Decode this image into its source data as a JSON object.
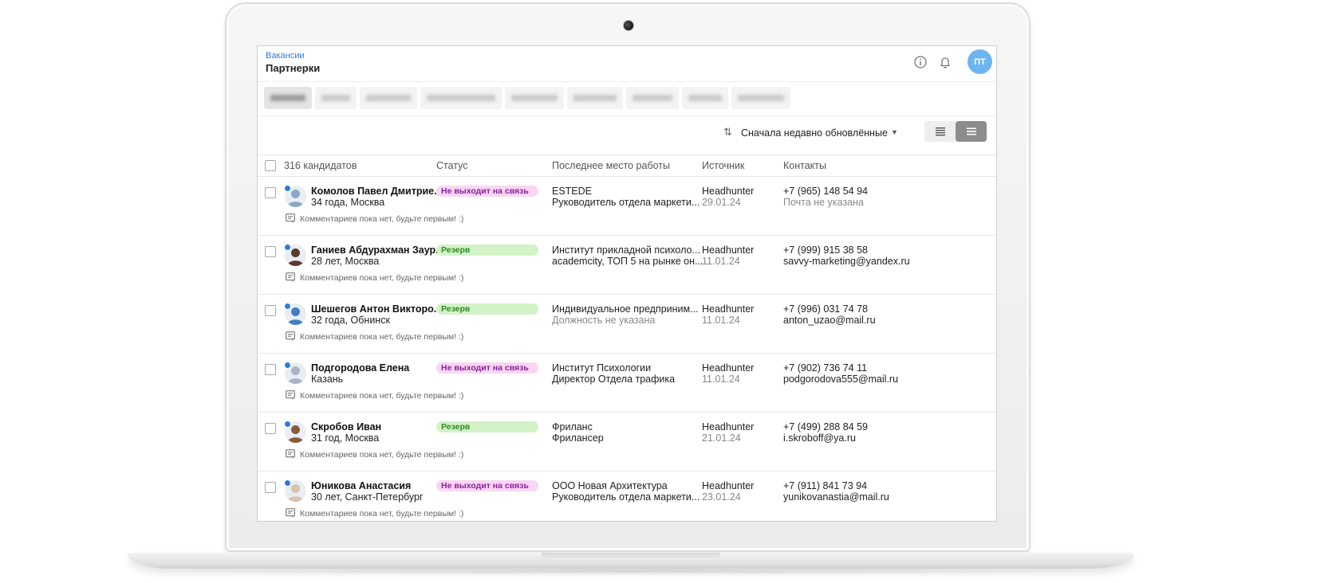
{
  "header": {
    "breadcrumb": "Вакансии",
    "title": "Партнерки",
    "user_initials": "ПТ"
  },
  "toolbar": {
    "sort_label": "Сначала недавно обновлённые"
  },
  "table": {
    "columns": {
      "count": "316 кандидатов",
      "status": "Статус",
      "last_job": "Последнее место работы",
      "source": "Источник",
      "contacts": "Контакты"
    },
    "rows": [
      {
        "name": "Комолов Павел Дмитрие...",
        "meta": "34 года, Москва",
        "comment": "Комментариев пока нет, будьте первым! :)",
        "status": "Не выходит на связь",
        "status_kind": "pink",
        "job_company": "ESTEDE",
        "job_title": "Руководитель отдела маркети...",
        "source": "Headhunter",
        "source_date": "29.01.24",
        "phone": "+7 (965) 148 54 94",
        "email": "Почта не указана",
        "avatar_color": "#8aa6c2"
      },
      {
        "name": "Ганиев Абдурахман Заур...",
        "meta": "28 лет, Москва",
        "comment": "Комментариев пока нет, будьте первым! :)",
        "status": "Резерв",
        "status_kind": "green",
        "job_company": "Институт прикладной психоло...",
        "job_title": "academcity, ТОП 5 на рынке он...",
        "source": "Headhunter",
        "source_date": "11.01.24",
        "phone": "+7 (999) 915 38 58",
        "email": "savvy-marketing@yandex.ru",
        "avatar_color": "#5a3a2a"
      },
      {
        "name": "Шешегов Антон Викторо...",
        "meta": "32 года, Обнинск",
        "comment": "Комментариев пока нет, будьте первым! :)",
        "status": "Резерв",
        "status_kind": "green",
        "job_company": "Индивидуальное предприним...",
        "job_title": "Должность не указана",
        "source": "Headhunter",
        "source_date": "11.01.24",
        "phone": "+7 (996) 031 74 78",
        "email": "anton_uzao@mail.ru",
        "avatar_color": "#3f7fc0"
      },
      {
        "name": "Подгородова Елена",
        "meta": "Казань",
        "comment": "Комментариев пока нет, будьте первым! :)",
        "status": "Не выходит на связь",
        "status_kind": "pink",
        "job_company": "Институт Психологии",
        "job_title": "Директор Отдела трафика",
        "source": "Headhunter",
        "source_date": "11.01.24",
        "phone": "+7 (902) 736 74 11",
        "email": "podgorodova555@mail.ru",
        "avatar_color": "#a9b4c4"
      },
      {
        "name": "Скробов Иван",
        "meta": "31 год, Москва",
        "comment": "Комментариев пока нет, будьте первым! :)",
        "status": "Резерв",
        "status_kind": "green",
        "job_company": "Фриланс",
        "job_title": "Фрилансер",
        "source": "Headhunter",
        "source_date": "21.01.24",
        "phone": "+7 (499) 288 84 59",
        "email": "i.skroboff@ya.ru",
        "avatar_color": "#8a5a3a"
      },
      {
        "name": "Юникова Анастасия",
        "meta": "30 лет, Санкт-Петербург",
        "comment": "Комментариев пока нет, будьте первым! :)",
        "status": "Не выходит на связь",
        "status_kind": "pink",
        "job_company": "ООО Новая Архитектура",
        "job_title": "Руководитель отдела маркети...",
        "source": "Headhunter",
        "source_date": "23.01.24",
        "phone": "+7 (911) 841 73 94",
        "email": "yunikovanastia@mail.ru",
        "avatar_color": "#d9c2b0"
      }
    ]
  },
  "icons": {
    "info": "info-icon",
    "bell": "bell-icon",
    "sort": "sort-icon",
    "caret": "chevron-down-icon",
    "view_compact": "list-compact-icon",
    "view_list": "list-icon",
    "comment": "comment-icon"
  },
  "colors": {
    "accent": "#2d7ae0",
    "user_avatar": "#6fb4f2",
    "status_pink_bg": "#fad6f2",
    "status_pink_text": "#8b1fa0",
    "status_green_bg": "#d3f2c8",
    "status_green_text": "#2f8a24"
  }
}
